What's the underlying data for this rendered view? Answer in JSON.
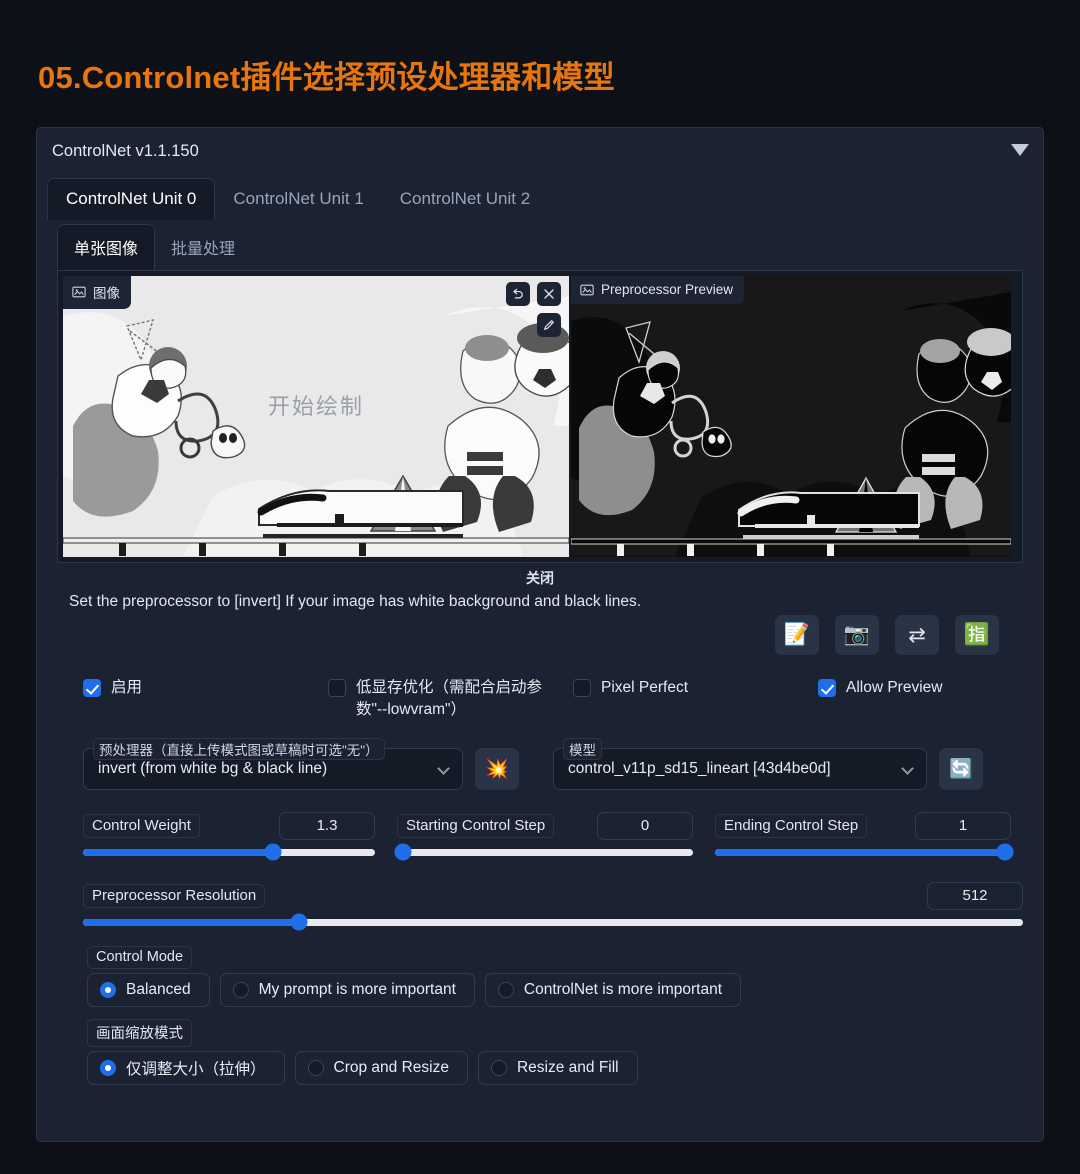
{
  "page": {
    "title": "05.Controlnet插件选择预设处理器和模型",
    "title_color": "#e8760f"
  },
  "panel": {
    "title": "ControlNet v1.1.150",
    "collapse_icon": "chevron-down-icon"
  },
  "unit_tabs": [
    {
      "label": "ControlNet Unit 0",
      "active": true
    },
    {
      "label": "ControlNet Unit 1",
      "active": false
    },
    {
      "label": "ControlNet Unit 2",
      "active": false
    }
  ],
  "sub_tabs": [
    {
      "label": "单张图像",
      "active": true
    },
    {
      "label": "批量处理",
      "active": false
    }
  ],
  "image_area": {
    "left_tag": "图像",
    "left_tag_icon": "image-icon",
    "right_tag": "Preprocessor Preview",
    "right_tag_icon": "image-icon",
    "placeholder": "开始绘制",
    "close_label": "关闭",
    "canvas_buttons": [
      {
        "icon": "undo-icon",
        "glyph": "↺"
      },
      {
        "icon": "close-icon",
        "glyph": "✕"
      },
      {
        "icon": "pen-icon",
        "glyph": "✎"
      }
    ]
  },
  "hint": "Set the preprocessor to [invert] If your image has white background and black lines.",
  "action_buttons": [
    {
      "name": "edit-note-button",
      "glyph": "📝"
    },
    {
      "name": "camera-button",
      "glyph": "📷"
    },
    {
      "name": "swap-button",
      "glyph": "⇄"
    },
    {
      "name": "japanese-symbol-button",
      "glyph": "🈯"
    }
  ],
  "checkboxes": [
    {
      "label": "启用",
      "checked": true
    },
    {
      "label": "低显存优化（需配合启动参数\"--lowvram\"）",
      "checked": false
    },
    {
      "label": "Pixel Perfect",
      "checked": false
    },
    {
      "label": "Allow Preview",
      "checked": true
    }
  ],
  "preprocessor": {
    "label": "预处理器（直接上传模式图或草稿时可选\"无\"）",
    "value": "invert (from white bg & black line)",
    "run_button_glyph": "💥"
  },
  "model": {
    "label": "模型",
    "value": "control_v11p_sd15_lineart [43d4be0d]",
    "refresh_button_glyph": "🔄"
  },
  "sliders": [
    {
      "label": "Control Weight",
      "value": "1.3",
      "pct": 65
    },
    {
      "label": "Starting Control Step",
      "value": "0",
      "pct": 0
    },
    {
      "label": "Ending Control Step",
      "value": "1",
      "pct": 100
    },
    {
      "label": "Preprocessor Resolution",
      "value": "512",
      "pct": 23
    }
  ],
  "control_mode": {
    "legend": "Control Mode",
    "options": [
      {
        "label": "Balanced",
        "selected": true
      },
      {
        "label": "My prompt is more important",
        "selected": false
      },
      {
        "label": "ControlNet is more important",
        "selected": false
      }
    ]
  },
  "resize_mode": {
    "legend": "画面缩放模式",
    "options": [
      {
        "label": "仅调整大小（拉伸）",
        "selected": true
      },
      {
        "label": "Crop and Resize",
        "selected": false
      },
      {
        "label": "Resize and Fill",
        "selected": false
      }
    ]
  },
  "colors": {
    "accent": "#1f6feb",
    "title": "#e8760f",
    "panel_bg": "#1b2231",
    "field_bg": "#141a26"
  }
}
